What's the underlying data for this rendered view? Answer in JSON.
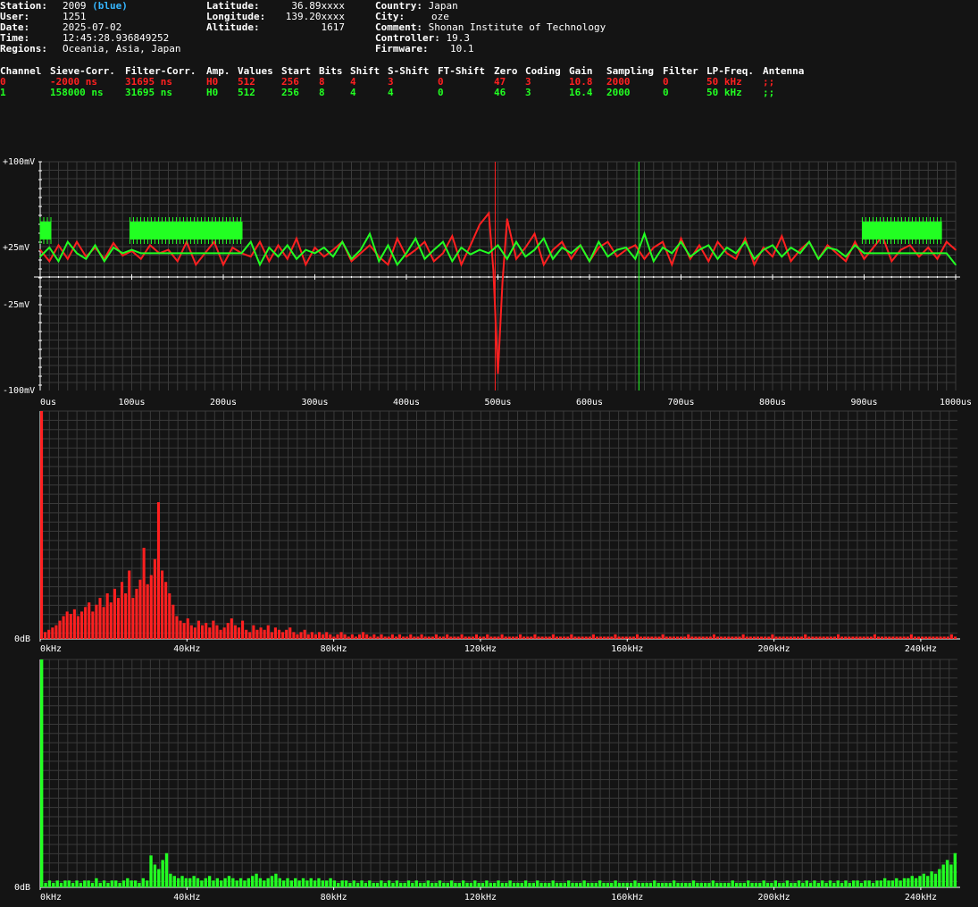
{
  "header": {
    "station_label": "Station:",
    "station": "2009",
    "station_color_name": "(blue)",
    "user_label": "User:",
    "user": "1251",
    "date_label": "Date:",
    "date": "2025-07-02",
    "time_label": "Time:",
    "time": "12:45:28.936849252",
    "regions_label": "Regions:",
    "regions": "Oceania, Asia, Japan",
    "latitude_label": "Latitude:",
    "latitude": "36.89xxxx",
    "longitude_label": "Longitude:",
    "longitude": "139.20xxxx",
    "altitude_label": "Altitude:",
    "altitude": "1617",
    "country_label": "Country:",
    "country": "Japan",
    "city_label": "City:",
    "city": "oze",
    "comment_label": "Comment:",
    "comment": "Shonan Institute of Technology",
    "controller_label": "Controller:",
    "controller": "19.3",
    "firmware_label": "Firmware:",
    "firmware": "10.1"
  },
  "channels_table": {
    "columns": [
      "Channel",
      "Sieve-Corr.",
      "Filter-Corr.",
      "Amp.",
      "Values",
      "Start",
      "Bits",
      "Shift",
      "S-Shift",
      "FT-Shift",
      "Zero",
      "Coding",
      "Gain",
      "Sampling",
      "Filter",
      "LP-Freq.",
      "Antenna"
    ],
    "rows": [
      {
        "color": "#ff2020",
        "cells": [
          "0",
          "-2000 ns",
          "31695 ns",
          "H0",
          "512",
          "256",
          "8",
          "4",
          "3",
          "0",
          "47",
          "3",
          "10.8",
          "2000",
          "0",
          "50 kHz",
          ";;"
        ]
      },
      {
        "color": "#22ff22",
        "cells": [
          "1",
          "158000 ns",
          "31695 ns",
          "H0",
          "512",
          "256",
          "8",
          "4",
          "4",
          "0",
          "46",
          "3",
          "16.4",
          "2000",
          "0",
          "50 kHz",
          ";;"
        ]
      }
    ]
  },
  "colors": {
    "background": "#141414",
    "grid": "#3a3a3a",
    "channel0": "#ff2020",
    "channel1": "#22ff22"
  },
  "chart_data": [
    {
      "type": "line",
      "y_tick_labels": [
        "+100mV",
        "+25mV",
        "-25mV",
        "-100mV"
      ],
      "x_tick_labels": [
        "0us",
        "100us",
        "200us",
        "300us",
        "400us",
        "500us",
        "600us",
        "700us",
        "800us",
        "900us",
        "1000us"
      ],
      "x_unit": "us",
      "xlim": [
        0,
        1000
      ],
      "ylim": [
        -100,
        100
      ],
      "markers": [
        {
          "channel": 0,
          "x": 497
        },
        {
          "channel": 1,
          "x": 654
        }
      ],
      "series": [
        {
          "channel": 0,
          "color": "#ff2020",
          "x": [
            0,
            10,
            20,
            30,
            40,
            50,
            60,
            70,
            80,
            90,
            100,
            110,
            120,
            130,
            140,
            150,
            160,
            170,
            180,
            190,
            200,
            210,
            220,
            230,
            240,
            250,
            260,
            270,
            280,
            290,
            300,
            310,
            320,
            330,
            340,
            350,
            360,
            370,
            380,
            390,
            400,
            410,
            420,
            430,
            440,
            450,
            460,
            470,
            480,
            490,
            495,
            500,
            505,
            510,
            520,
            530,
            540,
            550,
            560,
            570,
            580,
            590,
            600,
            610,
            620,
            630,
            640,
            650,
            660,
            670,
            680,
            690,
            700,
            710,
            720,
            730,
            740,
            750,
            760,
            770,
            780,
            790,
            800,
            810,
            820,
            830,
            840,
            850,
            860,
            870,
            880,
            890,
            900,
            910,
            920,
            930,
            940,
            950,
            960,
            970,
            980,
            990,
            1000
          ],
          "y": [
            48,
            38,
            52,
            40,
            55,
            42,
            50,
            40,
            54,
            43,
            47,
            40,
            52,
            45,
            48,
            38,
            55,
            35,
            45,
            55,
            35,
            50,
            45,
            42,
            55,
            38,
            52,
            40,
            58,
            35,
            50,
            42,
            48,
            55,
            38,
            45,
            52,
            42,
            35,
            58,
            42,
            48,
            55,
            38,
            45,
            60,
            35,
            52,
            70,
            80,
            30,
            -60,
            20,
            75,
            40,
            50,
            62,
            35,
            48,
            55,
            40,
            52,
            38,
            50,
            55,
            42,
            48,
            52,
            40,
            50,
            55,
            35,
            58,
            40,
            52,
            38,
            55,
            45,
            40,
            58,
            35,
            50,
            42,
            60,
            38,
            48,
            55,
            40,
            52,
            45,
            38,
            55,
            40,
            50,
            60,
            38,
            48,
            52,
            42,
            50,
            40,
            55,
            48
          ]
        },
        {
          "channel": 1,
          "color": "#22ff22",
          "x": [
            0,
            10,
            20,
            30,
            40,
            50,
            60,
            70,
            80,
            90,
            100,
            110,
            120,
            130,
            140,
            150,
            160,
            170,
            180,
            190,
            200,
            210,
            220,
            230,
            240,
            250,
            260,
            270,
            280,
            290,
            300,
            310,
            320,
            330,
            340,
            350,
            360,
            370,
            380,
            390,
            400,
            410,
            420,
            430,
            440,
            450,
            460,
            470,
            480,
            490,
            500,
            510,
            520,
            530,
            540,
            550,
            560,
            570,
            580,
            590,
            600,
            610,
            620,
            630,
            640,
            650,
            660,
            670,
            680,
            690,
            700,
            710,
            720,
            730,
            740,
            750,
            760,
            770,
            780,
            790,
            800,
            810,
            820,
            830,
            840,
            850,
            860,
            870,
            880,
            890,
            900,
            910,
            920,
            930,
            940,
            950,
            960,
            970,
            980,
            990,
            1000
          ],
          "y": [
            42,
            50,
            38,
            55,
            45,
            40,
            52,
            38,
            50,
            45,
            48,
            45,
            45,
            45,
            45,
            45,
            45,
            45,
            45,
            45,
            45,
            45,
            45,
            55,
            35,
            50,
            42,
            52,
            40,
            48,
            45,
            50,
            42,
            55,
            40,
            48,
            62,
            38,
            52,
            35,
            45,
            58,
            40,
            48,
            55,
            38,
            50,
            44,
            48,
            45,
            52,
            40,
            55,
            42,
            48,
            58,
            40,
            50,
            45,
            52,
            38,
            55,
            42,
            48,
            50,
            40,
            62,
            38,
            50,
            45,
            55,
            42,
            48,
            52,
            40,
            50,
            45,
            55,
            40,
            48,
            52,
            42,
            50,
            45,
            55,
            40,
            50,
            48,
            42,
            52,
            45,
            45,
            45,
            45,
            45,
            45,
            45,
            45,
            45,
            45,
            35
          ]
        }
      ]
    },
    {
      "type": "bar",
      "channel": 0,
      "color": "#ff2020",
      "x_tick_labels": [
        "0kHz",
        "40kHz",
        "80kHz",
        "120kHz",
        "160kHz",
        "200kHz",
        "240kHz"
      ],
      "x_unit": "kHz",
      "xlim": [
        0,
        250
      ],
      "y_tick_labels": [
        "0dB"
      ],
      "spectrum_max_x_khz": 250,
      "values": [
        100,
        3,
        4,
        5,
        6,
        8,
        10,
        12,
        11,
        13,
        10,
        12,
        14,
        16,
        12,
        15,
        18,
        14,
        20,
        16,
        22,
        18,
        25,
        20,
        30,
        18,
        22,
        26,
        40,
        24,
        28,
        35,
        60,
        30,
        25,
        20,
        15,
        10,
        8,
        7,
        9,
        6,
        5,
        8,
        6,
        7,
        5,
        8,
        6,
        4,
        5,
        7,
        9,
        6,
        5,
        8,
        4,
        3,
        6,
        4,
        5,
        4,
        6,
        3,
        5,
        4,
        3,
        4,
        5,
        3,
        2,
        3,
        4,
        2,
        3,
        2,
        3,
        2,
        3,
        2,
        1,
        2,
        3,
        2,
        1,
        2,
        1,
        2,
        3,
        2,
        1,
        2,
        1,
        2,
        1,
        1,
        2,
        1,
        2,
        1,
        1,
        2,
        1,
        1,
        2,
        1,
        1,
        1,
        2,
        1,
        1,
        2,
        1,
        1,
        1,
        2,
        1,
        1,
        1,
        2,
        1,
        1,
        2,
        1,
        1,
        1,
        2,
        1,
        1,
        1,
        1,
        2,
        1,
        1,
        1,
        2,
        1,
        1,
        1,
        1,
        2,
        1,
        1,
        1,
        1,
        2,
        1,
        1,
        1,
        1,
        1,
        2,
        1,
        1,
        1,
        1,
        1,
        2,
        1,
        1,
        1,
        1,
        1,
        2,
        1,
        1,
        1,
        1,
        1,
        1,
        2,
        1,
        1,
        1,
        1,
        1,
        1,
        2,
        1,
        1,
        1,
        1,
        1,
        1,
        2,
        1,
        1,
        1,
        1,
        1,
        1,
        1,
        2,
        1,
        1,
        1,
        1,
        1,
        1,
        1,
        2,
        1,
        1,
        1,
        1,
        1,
        1,
        1,
        1,
        2,
        1,
        1,
        1,
        1,
        1,
        1,
        1,
        1,
        2,
        1,
        1,
        1,
        1,
        1,
        1,
        1,
        1,
        1,
        2,
        1,
        1,
        1,
        1,
        1,
        1,
        1,
        1,
        1,
        2,
        1,
        1,
        1,
        1,
        1,
        1,
        1,
        1,
        1,
        1,
        2,
        1
      ]
    },
    {
      "type": "bar",
      "channel": 1,
      "color": "#22ff22",
      "x_tick_labels": [
        "0kHz",
        "40kHz",
        "80kHz",
        "120kHz",
        "160kHz",
        "200kHz",
        "240kHz"
      ],
      "x_unit": "kHz",
      "xlim": [
        0,
        250
      ],
      "y_tick_labels": [
        "0dB"
      ],
      "values": [
        100,
        2,
        3,
        2,
        3,
        2,
        3,
        3,
        2,
        3,
        2,
        3,
        3,
        2,
        4,
        2,
        3,
        2,
        3,
        3,
        2,
        3,
        4,
        3,
        3,
        2,
        4,
        3,
        14,
        10,
        8,
        12,
        15,
        6,
        5,
        4,
        5,
        4,
        4,
        5,
        4,
        3,
        4,
        5,
        3,
        4,
        3,
        4,
        5,
        4,
        3,
        4,
        3,
        4,
        5,
        6,
        4,
        3,
        4,
        5,
        6,
        4,
        3,
        4,
        3,
        4,
        3,
        4,
        3,
        4,
        3,
        4,
        3,
        3,
        4,
        3,
        2,
        3,
        3,
        2,
        3,
        2,
        3,
        2,
        3,
        2,
        2,
        3,
        2,
        3,
        2,
        3,
        2,
        2,
        3,
        2,
        3,
        2,
        2,
        3,
        2,
        2,
        3,
        2,
        2,
        3,
        2,
        2,
        3,
        2,
        2,
        3,
        2,
        2,
        3,
        2,
        2,
        3,
        2,
        2,
        3,
        2,
        2,
        2,
        3,
        2,
        2,
        3,
        2,
        2,
        2,
        3,
        2,
        2,
        2,
        3,
        2,
        2,
        2,
        3,
        2,
        2,
        2,
        3,
        2,
        2,
        2,
        3,
        2,
        2,
        2,
        2,
        3,
        2,
        2,
        2,
        2,
        3,
        2,
        2,
        2,
        2,
        3,
        2,
        2,
        2,
        2,
        3,
        2,
        2,
        2,
        2,
        3,
        2,
        2,
        2,
        2,
        3,
        2,
        2,
        2,
        3,
        2,
        2,
        2,
        3,
        2,
        2,
        3,
        2,
        2,
        3,
        2,
        2,
        3,
        2,
        3,
        2,
        3,
        2,
        3,
        2,
        3,
        2,
        3,
        2,
        3,
        2,
        3,
        3,
        2,
        3,
        3,
        2,
        3,
        3,
        4,
        3,
        3,
        4,
        3,
        4,
        4,
        5,
        4,
        5,
        6,
        5,
        7,
        6,
        8,
        10,
        12,
        10,
        15
      ]
    }
  ]
}
